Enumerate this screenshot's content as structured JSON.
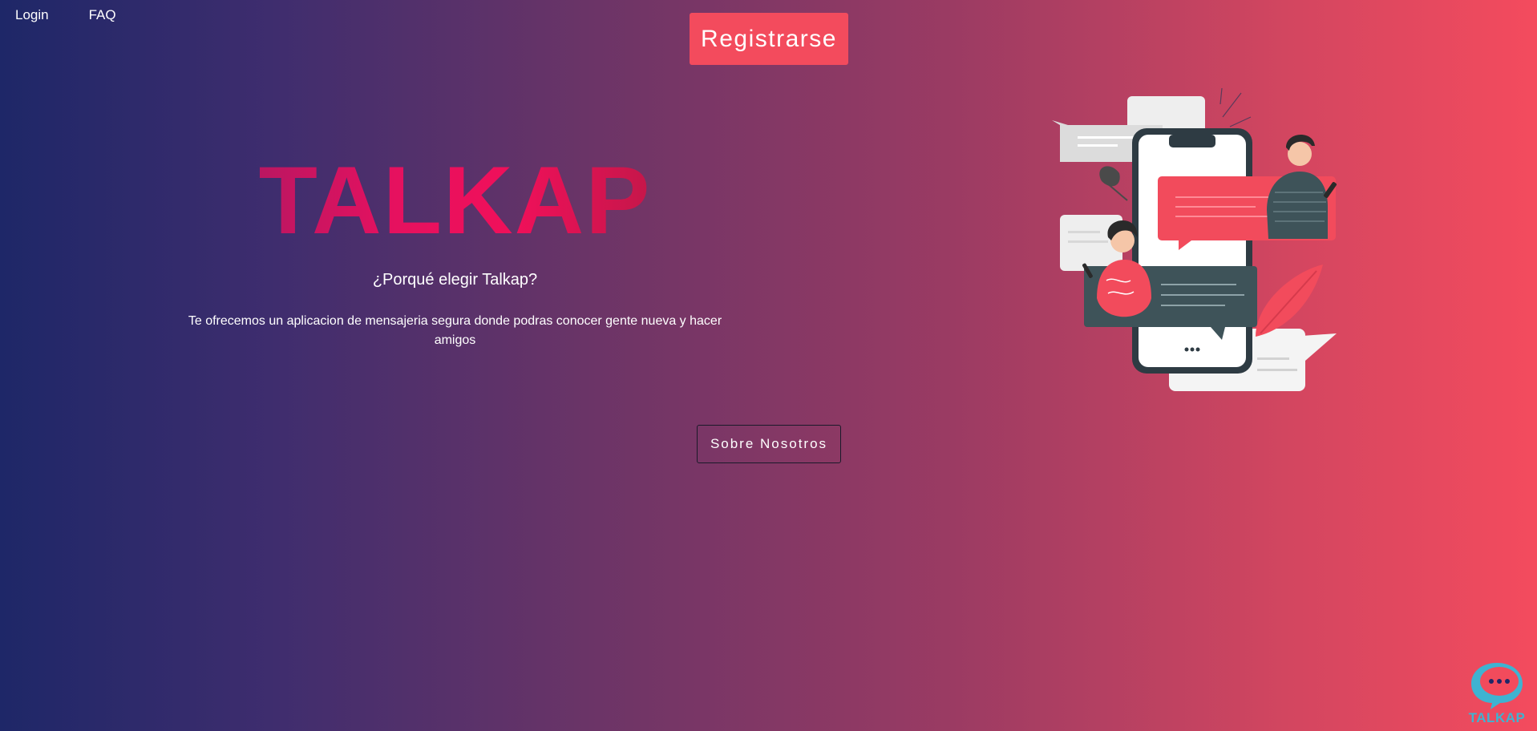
{
  "nav": {
    "login_label": "Login",
    "faq_label": "FAQ"
  },
  "header": {
    "register_label": "Registrarse"
  },
  "hero": {
    "brand_title": "TALKAP",
    "subtitle": "¿Porqué elegir Talkap?",
    "description": "Te ofrecemos un aplicacion de mensajeria segura donde podras conocer gente nueva y hacer amigos"
  },
  "about": {
    "button_label": "Sobre Nosotros"
  },
  "logo": {
    "text": "TALKAP",
    "icon": "chat-bubble-icon"
  },
  "illustration": {
    "icon": "chat-illustration"
  },
  "colors": {
    "gradient_start": "#1e2768",
    "gradient_end": "#f44b5e",
    "register_button": "#f34b5d",
    "logo_accent": "#3fb3d1"
  }
}
